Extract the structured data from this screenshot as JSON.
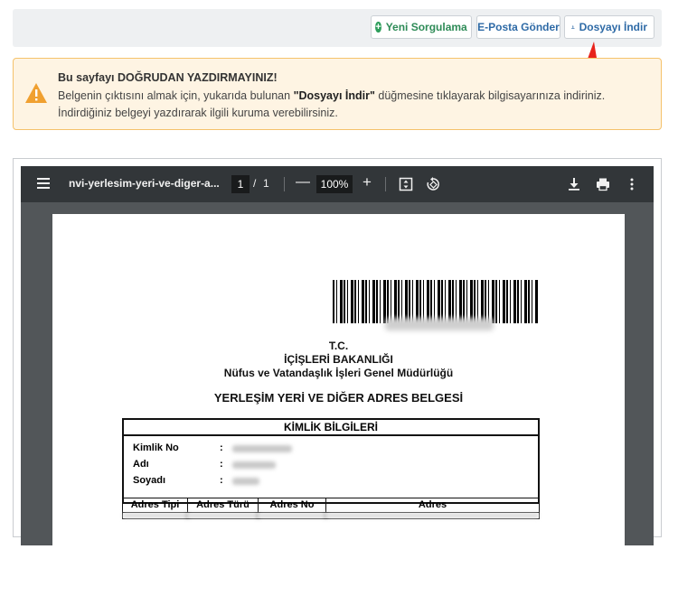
{
  "toolbar": {
    "new_query": "Yeni Sorgulama",
    "send_email": "E-Posta Gönder",
    "download": "Dosyayı İndir"
  },
  "warning": {
    "title": "Bu sayfayı DOĞRUDAN YAZDIRMAYINIZ!",
    "body_before": "Belgenin çıktısını almak için, yukarıda bulunan ",
    "body_bold": "\"Dosyayı İndir\"",
    "body_after": " düğmesine tıklayarak bilgisayarınıza indiriniz. İndirdiğiniz belgeyi yazdırarak ilgili kuruma verebilirsiniz."
  },
  "pdf_viewer": {
    "file_title": "nvi-yerlesim-yeri-ve-diger-a...",
    "current_page": "1",
    "page_sep": "/",
    "total_pages": "1",
    "zoom": "100%"
  },
  "document": {
    "line1": "T.C.",
    "line2": "İÇİŞLERİ BAKANLIĞI",
    "line3": "Nüfus ve Vatandaşlık İşleri Genel Müdürlüğü",
    "title": "YERLEŞİM YERİ VE DİĞER ADRES BELGESİ",
    "identity_header": "KİMLİK BİLGİLERİ",
    "fields": {
      "id_no_label": "Kimlik No",
      "name_label": "Adı",
      "surname_label": "Soyadı",
      "colon": ":"
    },
    "address_headers": [
      "Adres Tipi",
      "Adres Türü",
      "Adres No",
      "Adres"
    ]
  },
  "colors": {
    "warning_bg": "#fef4e3",
    "warning_border": "#f5c26b",
    "warning_icon": "#f0a030",
    "arrow": "#e8231c",
    "pdf_toolbar": "#323639"
  }
}
